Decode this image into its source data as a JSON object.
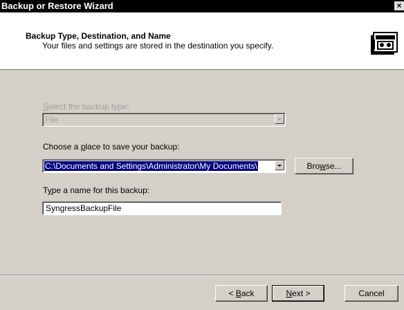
{
  "window": {
    "title": "Backup or Restore Wizard",
    "close_glyph": "×"
  },
  "header": {
    "title": "Backup Type, Destination, and Name",
    "subtitle": "Your files and settings are stored in the destination you specify.",
    "icon": "backup-tape-icon"
  },
  "form": {
    "backup_type": {
      "label_prefix": "",
      "label_accel": "S",
      "label_rest": "elect the backup type:",
      "value": "File",
      "enabled": false
    },
    "destination": {
      "label_prefix": "Choose a ",
      "label_accel": "p",
      "label_rest": "lace to save your backup:",
      "value": "C:\\Documents and Settings\\Administrator\\My Documents\\"
    },
    "browse_button": {
      "prefix": "Bro",
      "accel": "w",
      "rest": "se..."
    },
    "name": {
      "label_prefix": "T",
      "label_accel": "y",
      "label_rest": "pe a name for this backup:",
      "value": "SyngressBackupFile"
    }
  },
  "footer": {
    "back_button": {
      "prefix": "< ",
      "accel": "B",
      "rest": "ack"
    },
    "next_button": {
      "prefix": "",
      "accel": "N",
      "rest": "ext >"
    },
    "cancel_button": {
      "label": "Cancel"
    }
  }
}
